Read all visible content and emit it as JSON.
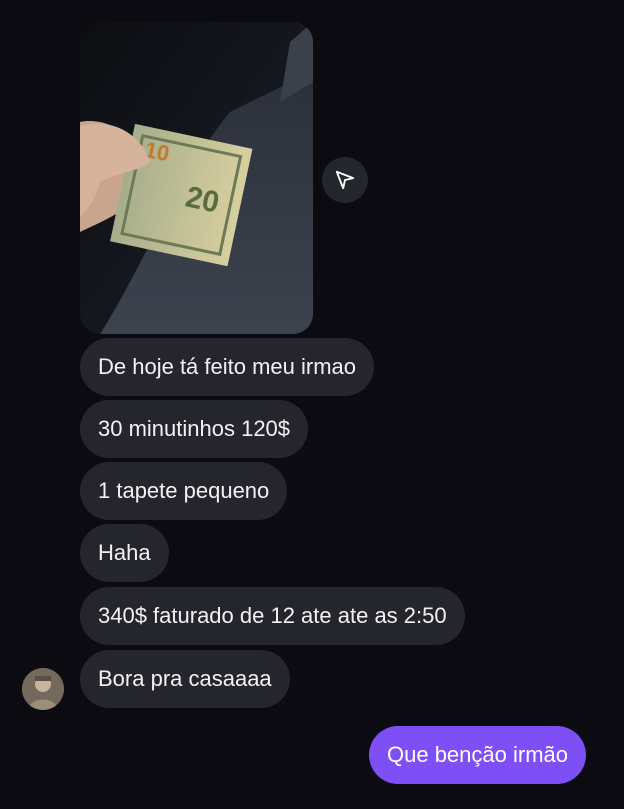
{
  "conversation": {
    "received_photo_alt": "",
    "received_messages": [
      "De hoje tá feito meu irmao",
      "30 minutinhos 120$",
      "1 tapete pequeno",
      "Haha",
      "340$ faturado de 12 ate ate as 2:50",
      "Bora pra casaaaa"
    ],
    "sent_messages": [
      "Que benção irmão"
    ],
    "photo_banknote_digits": "20",
    "photo_banknote_partial": "10"
  },
  "colors": {
    "background": "#0b0b11",
    "received_bubble": "#25262d",
    "sent_bubble": "#7d4ff5",
    "text": "#f2f2f2"
  },
  "icons": {
    "share": "send-paper-plane-icon",
    "avatar": "user-avatar"
  }
}
